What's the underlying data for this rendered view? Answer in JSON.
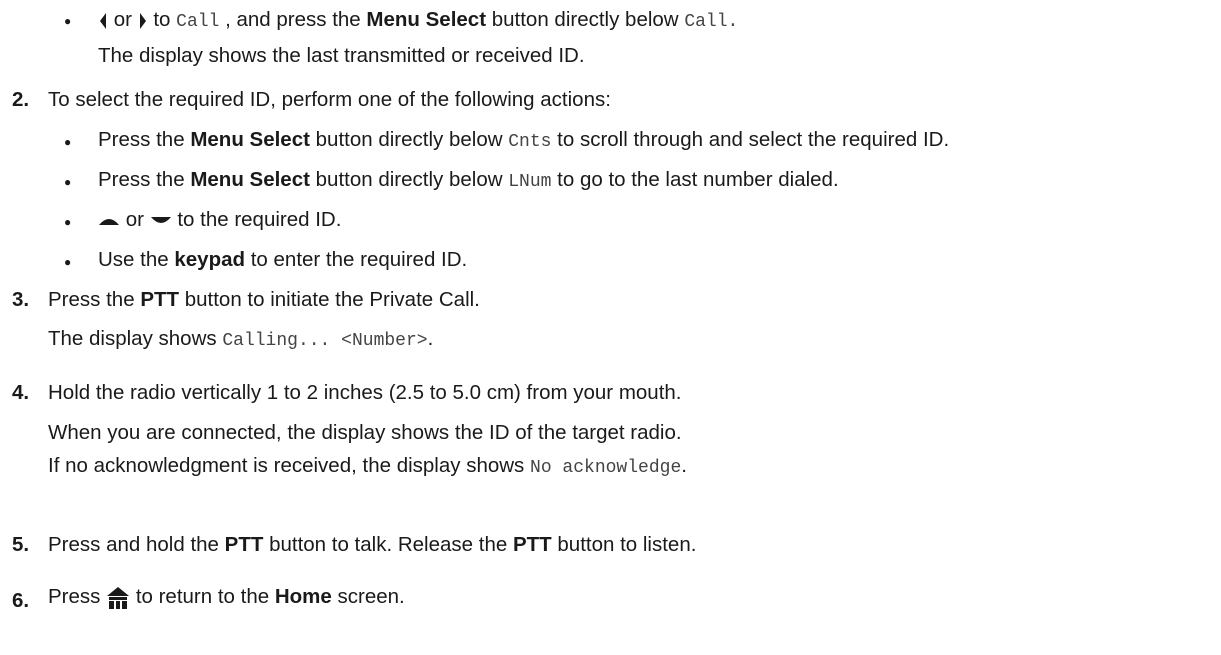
{
  "instructions": {
    "bullet1": {
      "or": "or",
      "to": "to",
      "call_code": "Call",
      "mid": ", and press the",
      "menu_select": "Menu Select",
      "below": "button directly below",
      "end": "."
    },
    "bullet1_note": "The display shows the last transmitted or received ID.",
    "step2": {
      "num": "2.",
      "text": "To select the required ID, perform one of the following actions:"
    },
    "step2_b1": {
      "pre": "Press the",
      "bold": "Menu Select",
      "mid": "button directly below",
      "code": "Cnts",
      "post": "to scroll through and select the required ID."
    },
    "step2_b2": {
      "pre": "Press the",
      "bold": "Menu Select",
      "mid": "button directly below",
      "code": "LNum",
      "post": "to go to the last number dialed."
    },
    "step2_b3": {
      "or": "or",
      "post": "to the required ID."
    },
    "step2_b4": {
      "pre": "Use the",
      "bold": "keypad",
      "post": "to enter the required ID."
    },
    "step3": {
      "num": "3.",
      "pre": "Press the",
      "bold": "PTT",
      "post": "button to initiate the Private Call."
    },
    "step3_note": {
      "pre": "The display shows",
      "code": "Calling... <Number>",
      "post": "."
    },
    "step4": {
      "num": "4.",
      "text": "Hold the radio vertically 1 to 2 inches (2.5 to 5.0 cm) from your mouth."
    },
    "step4_note1": "When you are connected, the display shows the ID of the target radio.",
    "step4_note2": {
      "pre": "If no acknowledgment is received, the display shows",
      "code": "No acknowledge",
      "post": "."
    },
    "step5": {
      "num": "5.",
      "pre": "Press and hold the",
      "bold1": "PTT",
      "mid": "button to talk. Release the",
      "bold2": "PTT",
      "post": "button to listen."
    },
    "step6": {
      "num": "6.",
      "pre": "Press",
      "mid": "to return to the",
      "bold": "Home",
      "post": "screen."
    }
  },
  "icons": {
    "left": "left-arrow-icon",
    "right": "right-arrow-icon",
    "up": "up-arrow-icon",
    "down": "down-arrow-icon",
    "home": "home-icon"
  }
}
